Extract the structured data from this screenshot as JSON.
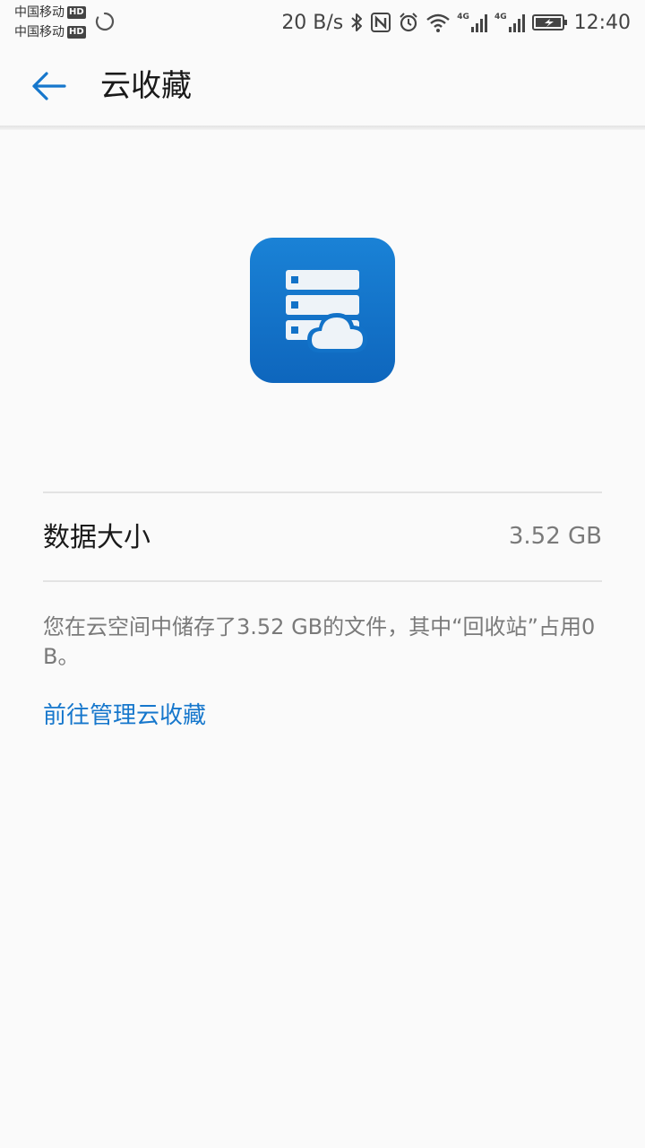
{
  "status_bar": {
    "carrier_1": "中国移动",
    "carrier_2": "中国移动",
    "hd_badge": "HD",
    "network_speed": "20 B/s",
    "signal_1_label": "4G",
    "signal_2_label": "4G",
    "time": "12:40",
    "icons": [
      "loading-icon",
      "bluetooth-icon",
      "nfc-icon",
      "alarm-icon",
      "wifi-icon",
      "signal-icon",
      "signal-icon",
      "battery-charging-icon"
    ]
  },
  "header": {
    "title": "云收藏",
    "back_icon": "arrow-left-icon"
  },
  "hero": {
    "icon": "cloud-server-icon",
    "accent_color": "#1272c8"
  },
  "storage": {
    "label": "数据大小",
    "value": "3.52 GB",
    "description": "您在云空间中储存了3.52 GB的文件，其中“回收站”占用0 B。",
    "manage_link": "前往管理云收藏"
  },
  "colors": {
    "link": "#1677cc",
    "secondary_text": "#7a7a7a",
    "background": "#fafafa"
  }
}
